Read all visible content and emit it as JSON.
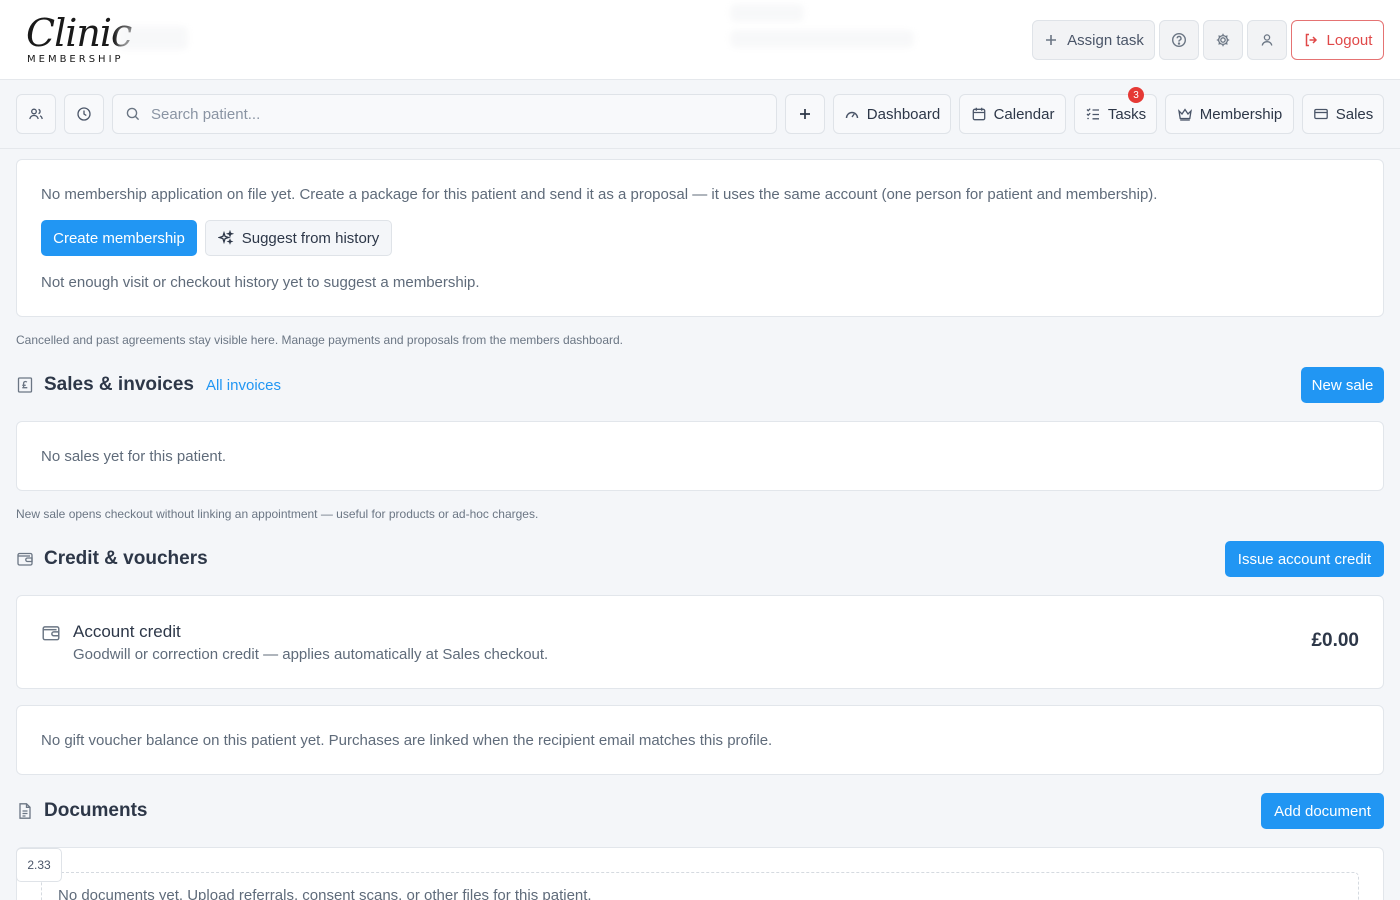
{
  "brand": {
    "script": "Clinic",
    "sub": "MEMBERSHIP"
  },
  "header": {
    "assign_task": "Assign task",
    "logout": "Logout"
  },
  "toolbar": {
    "search_placeholder": "Search patient...",
    "dashboard": "Dashboard",
    "calendar": "Calendar",
    "tasks": "Tasks",
    "tasks_badge": "3",
    "membership": "Membership",
    "sales": "Sales"
  },
  "membership_card": {
    "message": "No membership application on file yet. Create a package for this patient and send it as a proposal — it uses the same account (one person for patient and membership).",
    "create_button": "Create membership",
    "suggest_button": "Suggest from history",
    "history_note": "Not enough visit or checkout history yet to suggest a membership."
  },
  "membership_note": "Cancelled and past agreements stay visible here. Manage payments and proposals from the members dashboard.",
  "sales": {
    "title": "Sales & invoices",
    "all_invoices": "All invoices",
    "new_sale": "New sale",
    "empty": "No sales yet for this patient.",
    "note": "New sale opens checkout without linking an appointment — useful for products or ad-hoc charges."
  },
  "credit": {
    "title": "Credit & vouchers",
    "issue_button": "Issue account credit",
    "account_credit_title": "Account credit",
    "account_credit_desc": "Goodwill or correction credit — applies automatically at Sales checkout.",
    "account_credit_amount": "£0.00",
    "voucher_empty": "No gift voucher balance on this patient yet. Purchases are linked when the recipient email matches this profile."
  },
  "documents": {
    "title": "Documents",
    "add_button": "Add document",
    "empty": "No documents yet. Upload referrals, consent scans, or other files for this patient."
  },
  "corner_value": "2.33",
  "colors": {
    "primary": "#2196f3",
    "danger": "#e04848",
    "badge": "#e53935"
  }
}
